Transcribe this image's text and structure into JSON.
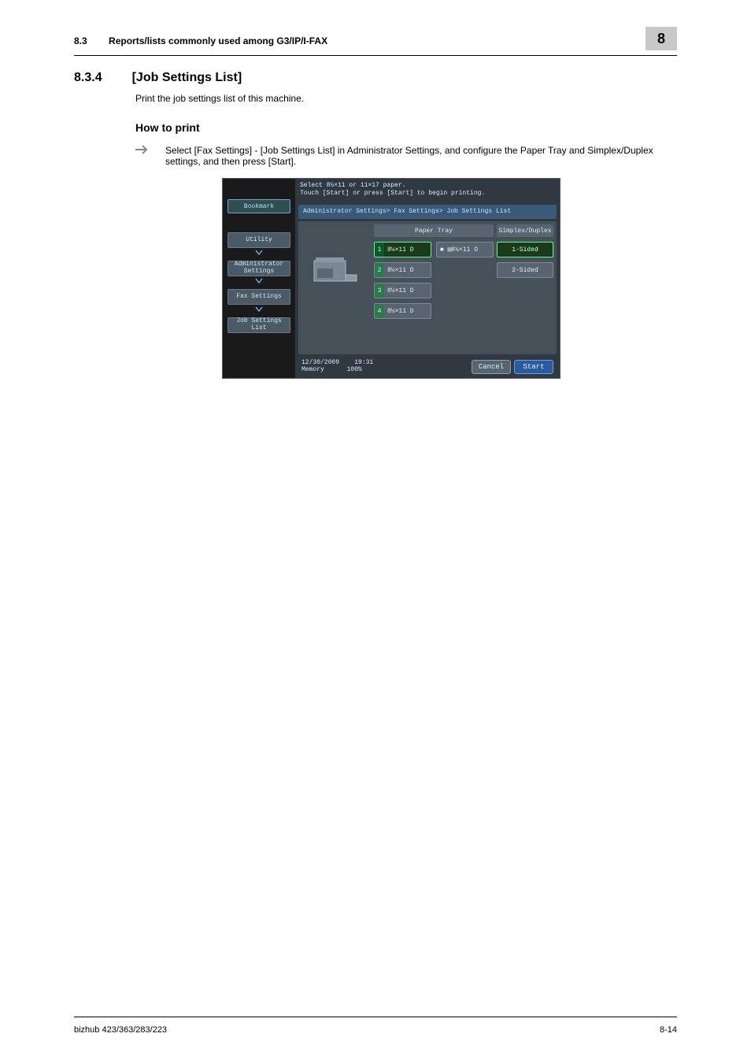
{
  "header": {
    "section_number": "8.3",
    "section_title": "Reports/lists commonly used among G3/IP/I-FAX",
    "chapter_number": "8"
  },
  "body": {
    "h3_number": "8.3.4",
    "h3_title": "[Job Settings List]",
    "intro_para": "Print the job settings list of this machine.",
    "h4_title": "How to print",
    "step_text": "Select [Fax Settings] - [Job Settings List] in Administrator Settings, and configure the Paper Tray and Simplex/Duplex settings, and then press [Start]."
  },
  "screenshot": {
    "hint_line1": "Select 8½×11 or 11×17 paper.",
    "hint_line2": "Touch [Start] or press [Start] to begin printing.",
    "bookmark": "Bookmark",
    "nav": [
      "Utility",
      "Administrator Settings",
      "Fax Settings",
      "Job Settings List"
    ],
    "breadcrumb": "Administrator Settings> Fax Settings> Job Settings List",
    "header_paper_tray": "Paper Tray",
    "header_duplex": "Simplex/Duplex",
    "trays": {
      "t1": {
        "num": "1",
        "label": "8½×11 D"
      },
      "bypass": {
        "label": "■ ▤8½×11 D"
      },
      "t2": {
        "num": "2",
        "label": "8½×11 D"
      },
      "t3": {
        "num": "3",
        "label": "8½×11 D"
      },
      "t4": {
        "num": "4",
        "label": "8½×11 D"
      }
    },
    "duplex": {
      "one": "1-Sided",
      "two": "2-Sided"
    },
    "status": {
      "date": "12/30/2009",
      "time": "19:31",
      "mem_label": "Memory",
      "mem_value": "100%"
    },
    "buttons": {
      "cancel": "Cancel",
      "start": "Start"
    }
  },
  "footer": {
    "product": "bizhub 423/363/283/223",
    "page": "8-14"
  }
}
